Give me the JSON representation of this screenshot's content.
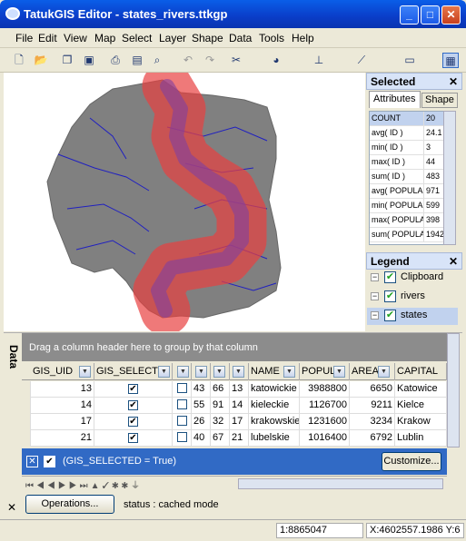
{
  "window": {
    "title": "TatukGIS Editor - states_rivers.ttkgp"
  },
  "menu": [
    "File",
    "Edit",
    "View",
    "Map",
    "Select",
    "Layer",
    "Shape",
    "Data",
    "Tools",
    "Help"
  ],
  "toolbar_icons": [
    "new-icon",
    "open-icon",
    "copy-layers-icon",
    "save-icon",
    "print-icon",
    "print-preview-icon",
    "find-icon",
    "undo-icon",
    "redo-icon",
    "cut-icon",
    "web-icon",
    "add-vertex-icon",
    "draw-line-icon",
    "measure-icon",
    "layout-icon"
  ],
  "selected_panel": {
    "title": "Selected",
    "tabs": [
      "Attributes",
      "Shape"
    ],
    "rows": [
      [
        "COUNT",
        "20"
      ],
      [
        "avg( ID )",
        "24.1"
      ],
      [
        "min( ID )",
        "3"
      ],
      [
        "max( ID )",
        "44"
      ],
      [
        "sum( ID )",
        "483"
      ],
      [
        "avg( POPULA",
        "971"
      ],
      [
        "min( POPULA",
        "599"
      ],
      [
        "max( POPULA",
        "398"
      ],
      [
        "sum( POPULA",
        "1942"
      ]
    ]
  },
  "legend": {
    "title": "Legend",
    "items": [
      "Clipboard",
      "rivers",
      "states"
    ]
  },
  "data": {
    "side_label": "Data",
    "group_hint": "Drag a column header here to group by that column",
    "columns": [
      "GIS_UID",
      "GIS_SELECT",
      "",
      "",
      "",
      "",
      "NAME",
      "POPUL",
      "AREA",
      "CAPITAL"
    ],
    "rows": [
      [
        "13",
        "43",
        "66",
        "13",
        "katowickie",
        "3988800",
        "6650",
        "Katowice"
      ],
      [
        "14",
        "55",
        "91",
        "14",
        "kieleckie",
        "1126700",
        "9211",
        "Kielce"
      ],
      [
        "17",
        "26",
        "32",
        "17",
        "krakowskie",
        "1231600",
        "3234",
        "Krakow"
      ],
      [
        "21",
        "40",
        "67",
        "21",
        "lubelskie",
        "1016400",
        "6792",
        "Lublin"
      ]
    ],
    "filter": "(GIS_SELECTED = True)",
    "customize": "Customize...",
    "operations": "Operations...",
    "status": "status : cached mode"
  },
  "statusbar": {
    "scale": "1:8865047",
    "coords": "X:4602557.1986  Y:6"
  }
}
